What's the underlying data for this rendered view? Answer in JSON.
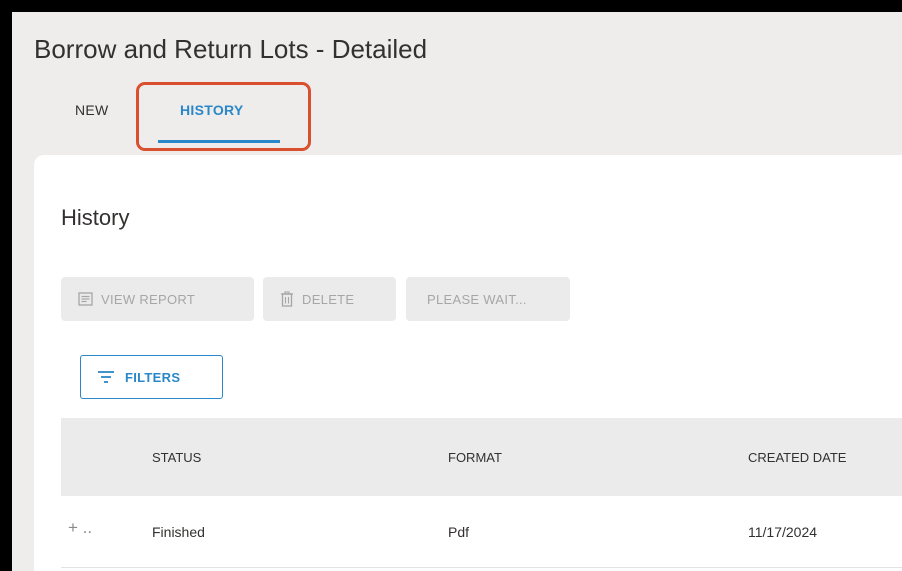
{
  "page": {
    "title": "Borrow and Return Lots - Detailed"
  },
  "tabs": [
    {
      "label": "NEW",
      "active": false
    },
    {
      "label": "HISTORY",
      "active": true
    }
  ],
  "section": {
    "title": "History"
  },
  "toolbar": {
    "view_report_label": "VIEW REPORT",
    "view_report_icon": "document-icon",
    "delete_label": "DELETE",
    "delete_icon": "trash-icon",
    "please_wait_label": "PLEASE WAIT...",
    "filters_label": "FILTERS",
    "filters_icon": "filter-lines-icon"
  },
  "table": {
    "columns": [
      "STATUS",
      "FORMAT",
      "CREATED DATE"
    ],
    "rows": [
      {
        "expand": "+ ..",
        "status": "Finished",
        "format": "Pdf",
        "created_date": "11/17/2024"
      }
    ]
  },
  "colors": {
    "accent": "#2b88c8",
    "highlight": "#d9502f",
    "background": "#eeedeb",
    "panel": "#ffffff",
    "disabled_button": "#ebebeb",
    "header_row": "#ebebeb"
  }
}
